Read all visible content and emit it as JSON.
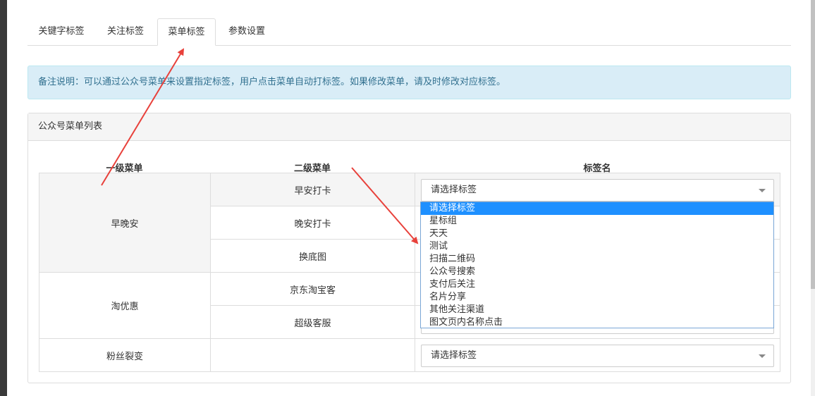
{
  "tabs": [
    "关键字标签",
    "关注标签",
    "菜单标签",
    "参数设置"
  ],
  "active_tab_index": 2,
  "note": "备注说明：可以通过公众号菜单来设置指定标签，用户点击菜单自动打标签。如果修改菜单，请及时修改对应标签。",
  "panel": {
    "title": "公众号菜单列表",
    "headers": [
      "一级菜单",
      "二级菜单",
      "标签名"
    ],
    "groups": [
      {
        "primary": "早晚安",
        "secondary": [
          "早安打卡",
          "晚安打卡",
          "换底图"
        ]
      },
      {
        "primary": "淘优惠",
        "secondary": [
          "京东淘宝客",
          "超级客服"
        ]
      },
      {
        "primary": "粉丝裂变",
        "secondary": [
          ""
        ]
      }
    ],
    "select_placeholder": "请选择标签"
  },
  "dropdown": {
    "options": [
      "请选择标签",
      "星标组",
      "天天",
      "测试",
      "扫描二维码",
      "公众号搜索",
      "支付后关注",
      "名片分享",
      "其他关注渠道",
      "图文页内名称点击"
    ],
    "selected_index": 0
  },
  "colors": {
    "note_bg": "#d9edf7",
    "note_text": "#31708f",
    "dropdown_highlight": "#1e90ff",
    "arrow": "#e8413b"
  }
}
